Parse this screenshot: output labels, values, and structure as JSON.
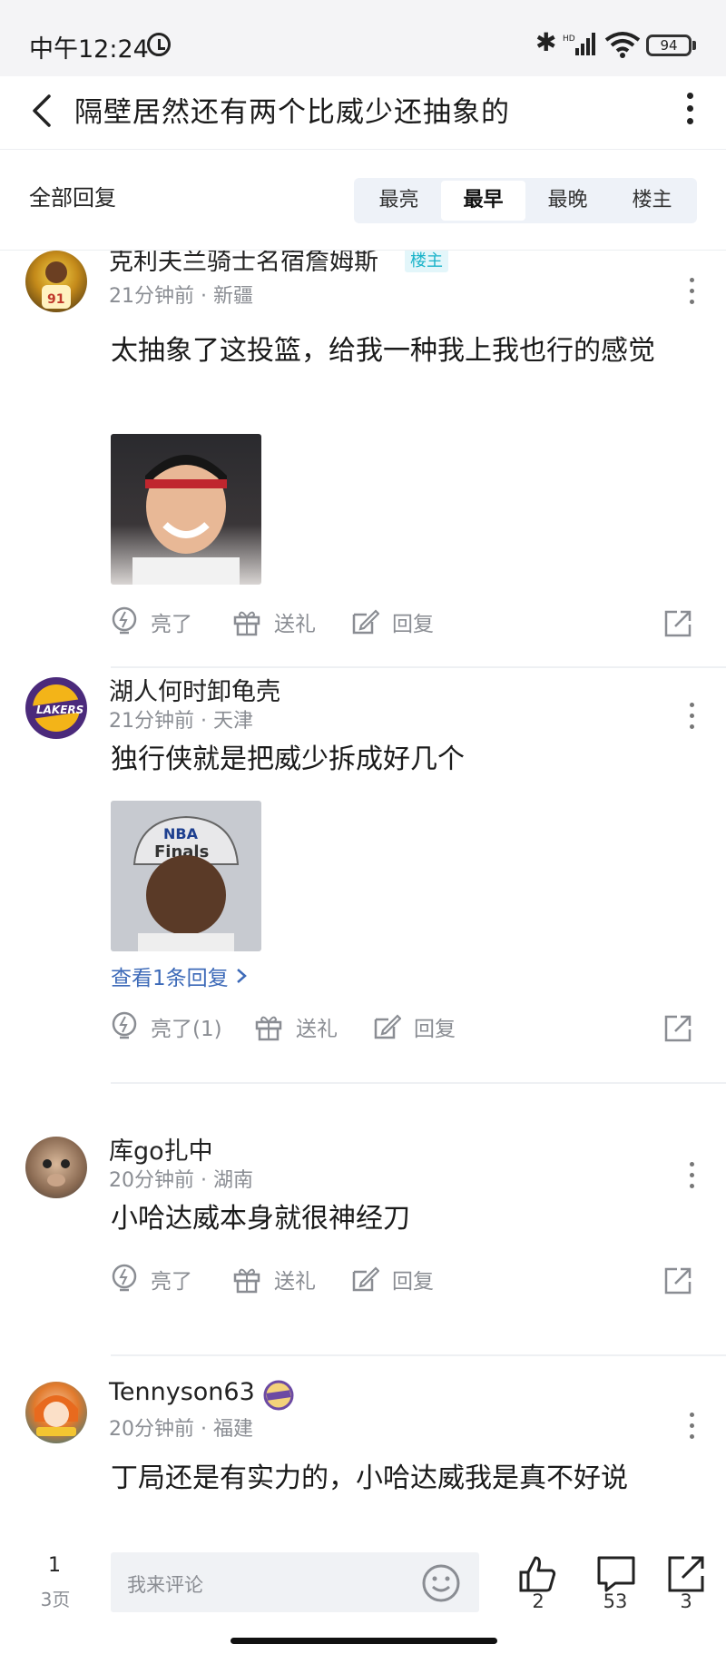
{
  "status_bar": {
    "time": "中午12:24",
    "battery": "94"
  },
  "header": {
    "title": "隔壁居然还有两个比威少还抽象的"
  },
  "sort_bar": {
    "all_replies_label": "全部回复",
    "tabs": [
      {
        "label": "最亮",
        "active": false
      },
      {
        "label": "最早",
        "active": true
      },
      {
        "label": "最晚",
        "active": false
      },
      {
        "label": "楼主",
        "active": false
      }
    ]
  },
  "posts": [
    {
      "username": "克利夫兰骑士名宿詹姆斯",
      "badge": "楼主",
      "time": "21分钟前",
      "location": "新疆",
      "content": "太抽象了这投篮，给我一种我上我也行的感觉",
      "actions": {
        "light": "亮了",
        "gift": "送礼",
        "reply": "回复"
      }
    },
    {
      "username": "湖人何时卸龟壳",
      "time": "21分钟前",
      "location": "天津",
      "content": "独行侠就是把威少拆成好几个",
      "view_replies": "查看1条回复",
      "actions": {
        "light": "亮了(1)",
        "gift": "送礼",
        "reply": "回复"
      }
    },
    {
      "username": "库go扎中",
      "time": "20分钟前",
      "location": "湖南",
      "content": "小哈达威本身就很神经刀",
      "actions": {
        "light": "亮了",
        "gift": "送礼",
        "reply": "回复"
      }
    },
    {
      "username": "Tennyson63",
      "time": "20分钟前",
      "location": "福建",
      "content": "丁局还是有实力的，小哈达威我是真不好说"
    }
  ],
  "separator": " · ",
  "bottom_bar": {
    "page_current": "1",
    "page_total": "3页",
    "comment_placeholder": "我来评论",
    "likes": "2",
    "comments": "53",
    "shares": "3"
  }
}
